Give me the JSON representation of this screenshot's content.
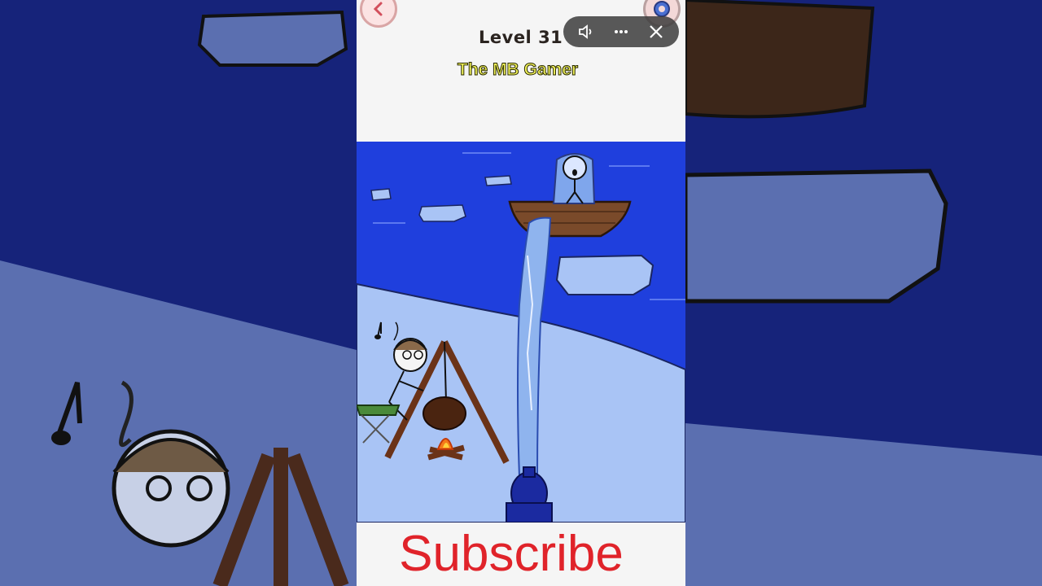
{
  "game": {
    "level_label": "Level 31",
    "channel_label": "The MB Gamer",
    "subscribe_label": "Subscribe"
  },
  "icons": {
    "back": "back-arrow-icon",
    "settings": "gear-icon",
    "sound": "speaker-icon",
    "more": "more-dots-icon",
    "close": "close-icon",
    "music": "music-note-icon"
  },
  "colors": {
    "sea": "#1f3fdd",
    "ice": "#a9c4f5",
    "water_jet": "#8fb4ee",
    "subscribe": "#e0232a",
    "level_text": "#2b2420",
    "channel_text": "#f2f35a"
  }
}
